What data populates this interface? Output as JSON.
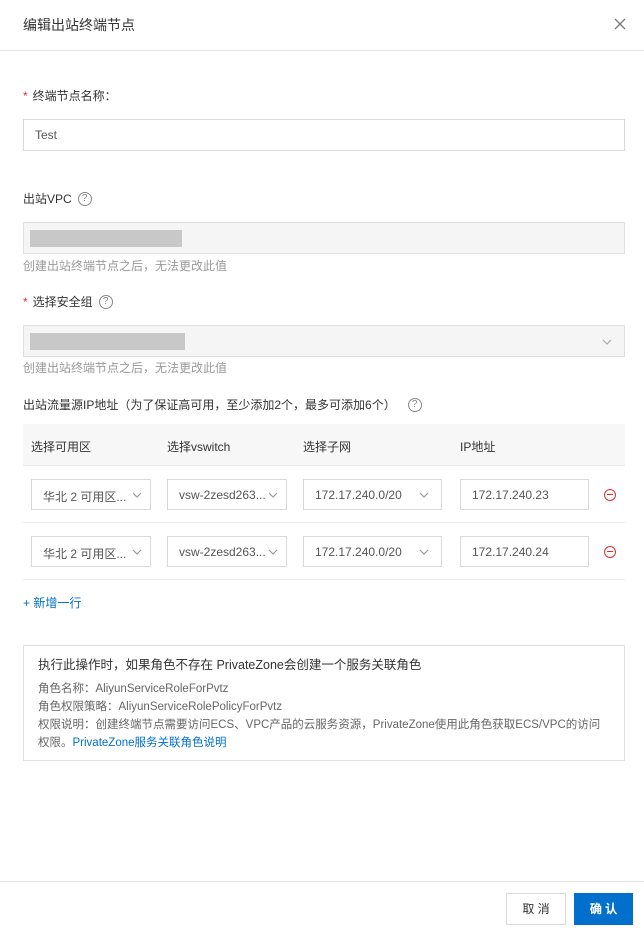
{
  "dialog": {
    "title": "编辑出站终端节点",
    "close_icon": "close-icon"
  },
  "form": {
    "name": {
      "required": "*",
      "label": "终端节点名称：",
      "value": "Test"
    },
    "vpc": {
      "label": "出站VPC",
      "help": "?",
      "hint": "创建出站终端节点之后，无法更改此值"
    },
    "security_group": {
      "required": "*",
      "label": "选择安全组",
      "help": "?",
      "hint": "创建出站终端节点之后，无法更改此值"
    },
    "source_ip": {
      "label": "出站流量源IP地址（为了保证高可用，至少添加2个，最多可添加6个）",
      "help": "?"
    }
  },
  "table": {
    "headers": [
      "选择可用区",
      "选择vswitch",
      "选择子网",
      "IP地址"
    ],
    "rows": [
      {
        "zone": "华北 2 可用区...",
        "vswitch": "vsw-2zesd263...",
        "subnet": "172.17.240.0/20",
        "ip": "172.17.240.23"
      },
      {
        "zone": "华北 2 可用区...",
        "vswitch": "vsw-2zesd263...",
        "subnet": "172.17.240.0/20",
        "ip": "172.17.240.24"
      }
    ],
    "add_row": "+ 新增一行"
  },
  "notice": {
    "title": "执行此操作时，如果角色不存在 PrivateZone会创建一个服务关联角色",
    "role_name": "角色名称：AliyunServiceRoleForPvtz",
    "role_policy": "角色权限策略：AliyunServiceRolePolicyForPvtz",
    "permission_desc": "权限说明：创建终端节点需要访问ECS、VPC产品的云服务资源，PrivateZone使用此角色获取ECS/VPC的访问权限。",
    "link": "PrivateZone服务关联角色说明"
  },
  "footer": {
    "cancel": "取 消",
    "confirm": "确 认"
  },
  "colors": {
    "primary": "#0070cc",
    "danger": "#e62d2d"
  }
}
